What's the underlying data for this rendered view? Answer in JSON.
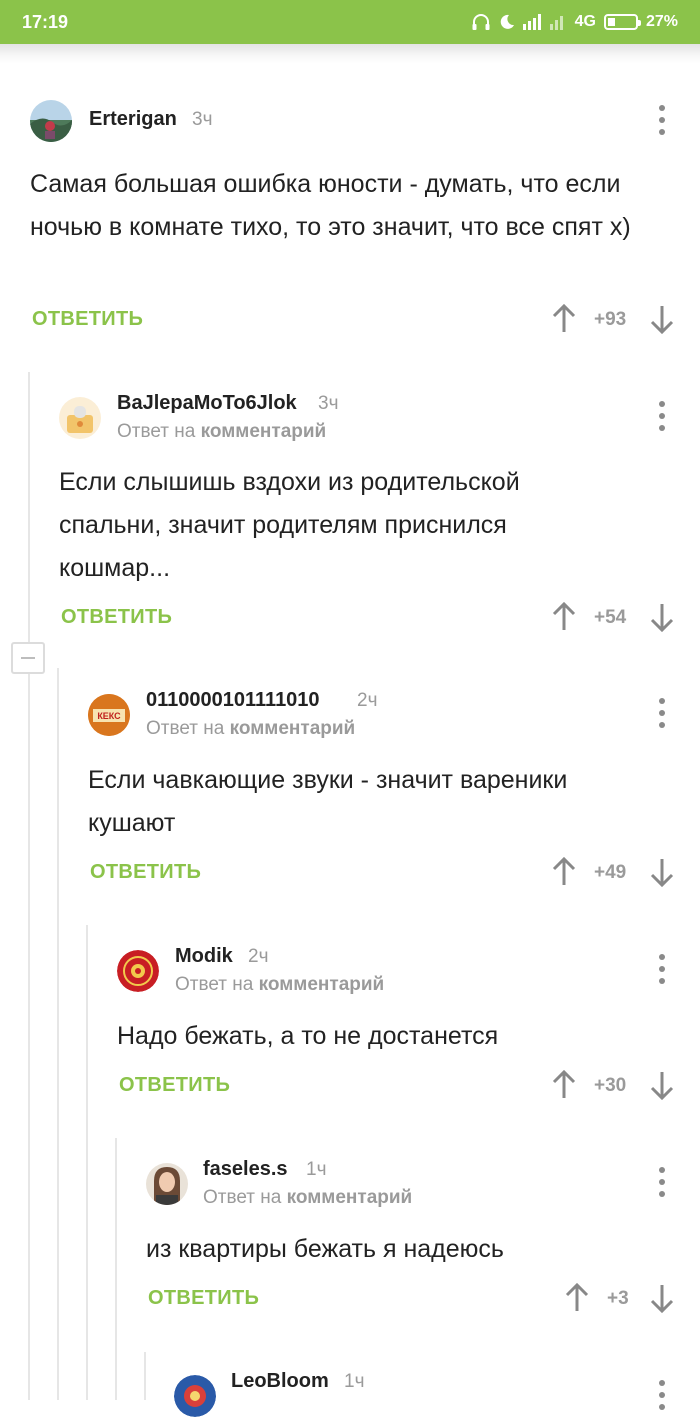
{
  "status_bar": {
    "time": "17:19",
    "network": "4G",
    "battery": "27%",
    "battery_level": 0.27
  },
  "reply_label": "ОТВЕТИТЬ",
  "reply_to_prefix": "Ответ на",
  "reply_to_link": "комментарий",
  "colors": {
    "accent": "#8bc34a",
    "muted": "#9a9a9a",
    "text": "#222222"
  },
  "comments": [
    {
      "user": "Erterigan",
      "age": "3ч",
      "text": "Самая большая ошибка юности - думать, что если ночью в комнате тихо, то это значит, что все спят х)",
      "score": "+93"
    },
    {
      "user": "BaJlepaMoTo6Jlok",
      "age": "3ч",
      "text": "Если слышишь вздохи из родительской спальни, значит родителям приснился кошмар...",
      "score": "+54"
    },
    {
      "user": "0110000101111010",
      "age": "2ч",
      "text": "Если чавкающие звуки - значит вареники кушают",
      "score": "+49",
      "avatar_text": "КЕКС"
    },
    {
      "user": "Modik",
      "age": "2ч",
      "text": "Надо бежать, а то не достанется",
      "score": "+30"
    },
    {
      "user": "faseles.s",
      "age": "1ч",
      "text": "из квартиры бежать я надеюсь",
      "score": "+3"
    },
    {
      "user": "LeoBloom",
      "age": "1ч"
    }
  ]
}
